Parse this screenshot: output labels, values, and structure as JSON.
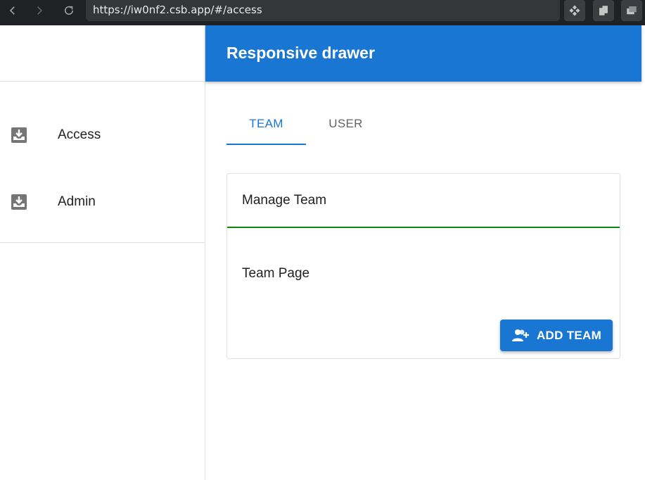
{
  "browser": {
    "url": "https://iw0nf2.csb.app/#/access",
    "icons": [
      "back-icon",
      "forward-icon",
      "reload-icon",
      "extension-icon",
      "copy-icon",
      "window-icon"
    ]
  },
  "drawer": {
    "items": [
      {
        "label": "Access",
        "icon": "inbox-icon"
      },
      {
        "label": "Admin",
        "icon": "inbox-icon"
      }
    ]
  },
  "appbar": {
    "title": "Responsive drawer",
    "color": "#1976d2"
  },
  "tabs": [
    {
      "label": "TEAM",
      "selected": true
    },
    {
      "label": "USER",
      "selected": false
    }
  ],
  "card": {
    "header": "Manage Team",
    "body": "Team Page",
    "button_label": "ADD TEAM",
    "button_icon": "group-add-icon",
    "accent_color": "#0a8a0a"
  }
}
